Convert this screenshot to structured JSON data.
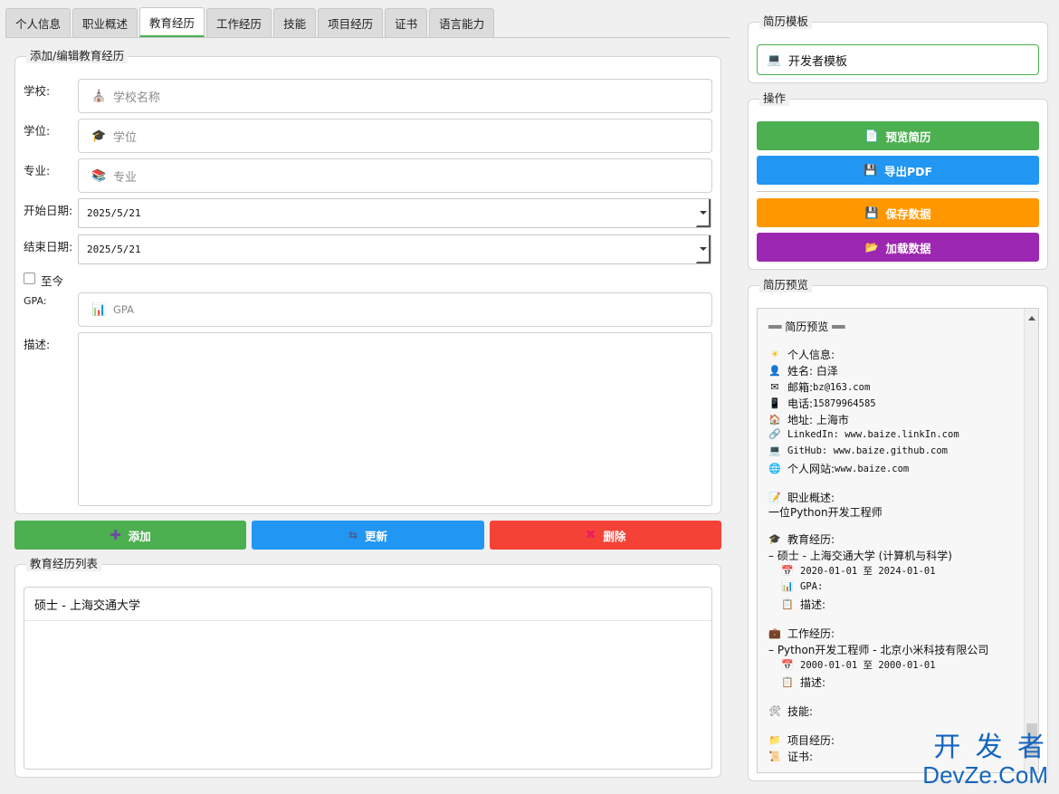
{
  "tabs": [
    "个人信息",
    "职业概述",
    "教育经历",
    "工作经历",
    "技能",
    "项目经历",
    "证书",
    "语言能力"
  ],
  "active_tab": "教育经历",
  "edit_group": {
    "title": "添加/编辑教育经历",
    "school_label": "学校:",
    "school_placeholder": "学校名称",
    "degree_label": "学位:",
    "degree_placeholder": "学位",
    "major_label": "专业:",
    "major_placeholder": "专业",
    "start_label": "开始日期:",
    "start_value": "2025/5/21",
    "end_label": "结束日期:",
    "end_value": "2025/5/21",
    "present_label": "至今",
    "gpa_label": "GPA:",
    "gpa_placeholder": "GPA",
    "desc_label": "描述:"
  },
  "actions": {
    "add": "添加",
    "update": "更新",
    "delete": "删除"
  },
  "list_group": {
    "title": "教育经历列表",
    "items": [
      "硕士 - 上海交通大学"
    ]
  },
  "template_group": {
    "title": "简历模板",
    "selected": "开发者模板"
  },
  "ops_group": {
    "title": "操作",
    "preview": "预览简历",
    "export": "导出PDF",
    "save": "保存数据",
    "load": "加载数据"
  },
  "preview_group": {
    "title": "简历预览",
    "heading": "══ 简历预览 ══",
    "personal_header": "个人信息:",
    "name": "姓名: 白泽",
    "email_label": "邮箱: ",
    "email": "bz@163.com",
    "phone_label": "电话: ",
    "phone": "15879964585",
    "address": "地址: 上海市",
    "linkedin": "LinkedIn: www.baize.linkIn.com",
    "github": "GitHub: www.baize.github.com",
    "website_label": "个人网站: ",
    "website": "www.baize.com",
    "summary_header": "职业概述:",
    "summary": "一位Python开发工程师",
    "edu_header": "教育经历:",
    "edu_item": "– 硕士 - 上海交通大学 (计算机与科学)",
    "edu_dates": "2020-01-01 至 2024-01-01",
    "edu_gpa": "GPA:",
    "edu_desc": "描述:",
    "work_header": "工作经历:",
    "work_item": "– Python开发工程师 - 北京小米科技有限公司",
    "work_dates": "2000-01-01 至 2000-01-01",
    "work_desc": "描述:",
    "skills_header": "技能:",
    "projects_header": "项目经历:",
    "certs_header": "证书:"
  },
  "watermark": {
    "line1": "开 发 者",
    "line2": "DevZe.CoM"
  },
  "colors": {
    "green": "#4caf50",
    "blue": "#2196f3",
    "red": "#f44336",
    "orange": "#ff9800",
    "purple": "#9c27b0"
  }
}
